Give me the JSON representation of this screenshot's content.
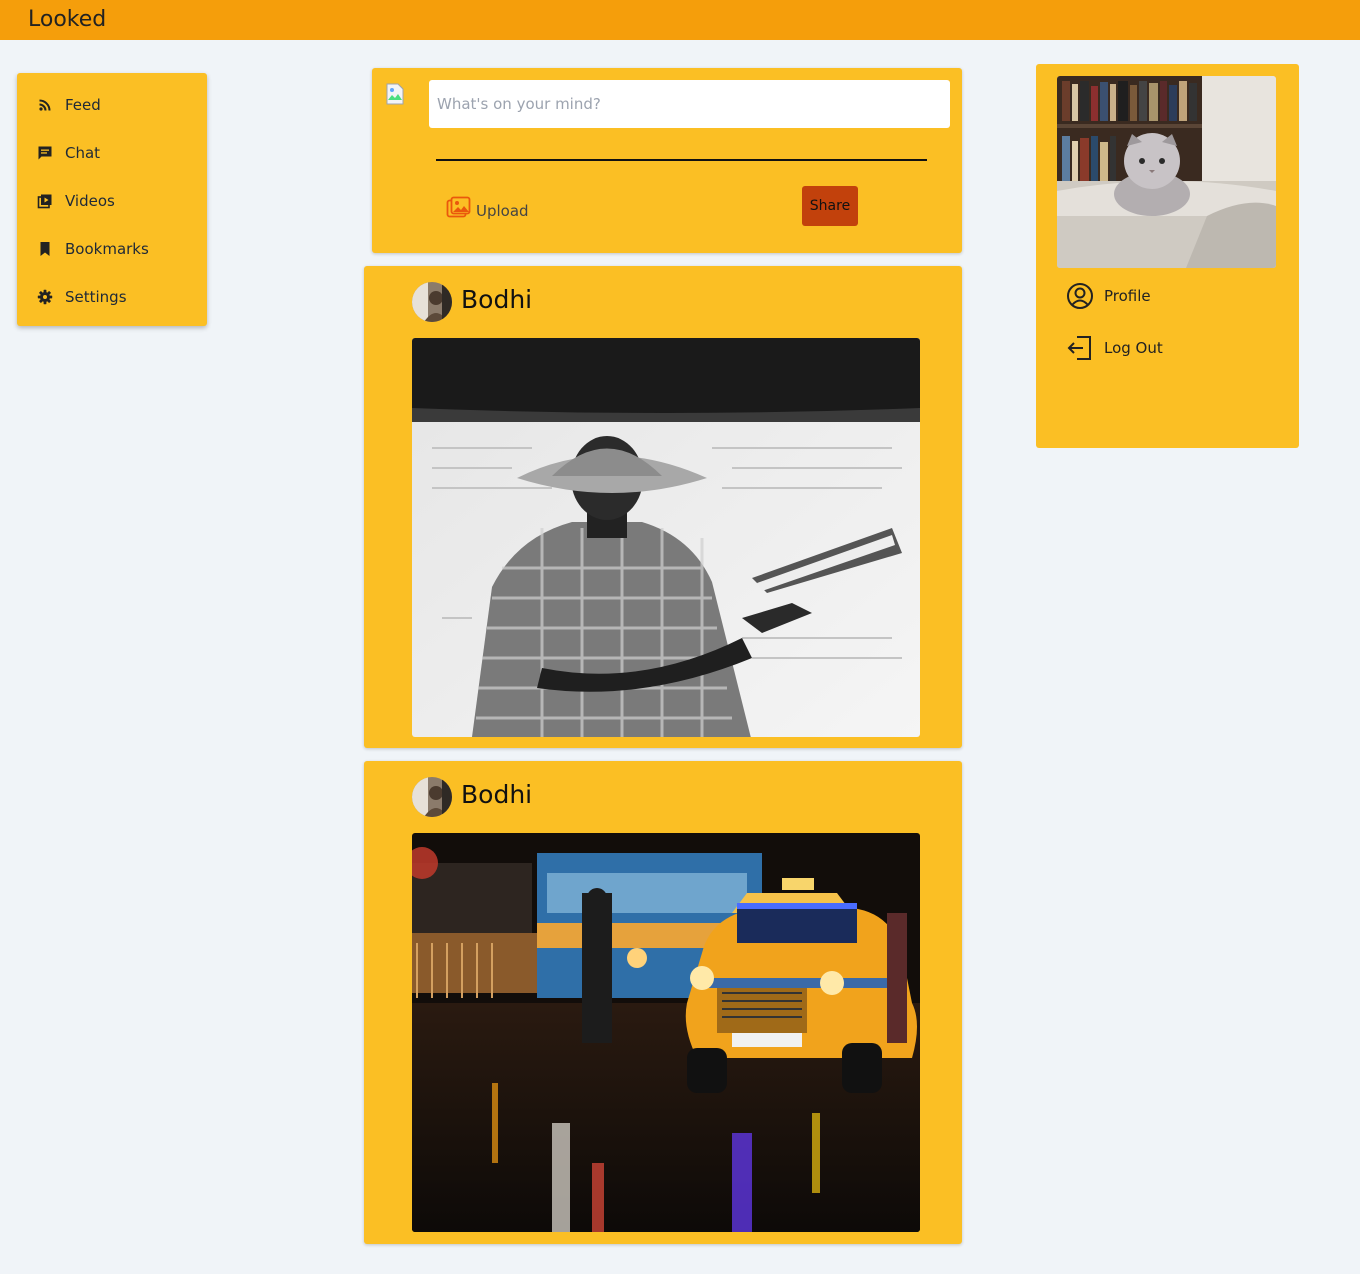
{
  "app": {
    "title": "Looked"
  },
  "sidebar": {
    "items": [
      {
        "label": "Feed",
        "icon": "rss-icon"
      },
      {
        "label": "Chat",
        "icon": "chat-icon"
      },
      {
        "label": "Videos",
        "icon": "video-library-icon"
      },
      {
        "label": "Bookmarks",
        "icon": "bookmark-icon"
      },
      {
        "label": "Settings",
        "icon": "gear-icon"
      }
    ]
  },
  "composer": {
    "placeholder": "What's on your mind?",
    "value": "",
    "upload_label": "Upload",
    "share_label": "Share"
  },
  "posts": [
    {
      "author": "Bodhi",
      "photo": "black-and-white man in bucket hat holding a book"
    },
    {
      "author": "Bodhi",
      "photo": "yellow taxi on wet street at night"
    }
  ],
  "profile_card": {
    "photo": "grey cat on couch in front of bookshelf",
    "links": [
      {
        "label": "Profile",
        "icon": "user-circle-icon"
      },
      {
        "label": "Log Out",
        "icon": "logout-icon"
      }
    ]
  },
  "colors": {
    "topbar": "#f59e0b",
    "card": "#fbbf24",
    "background": "#f0f4f8",
    "share_button": "#c2410c"
  }
}
